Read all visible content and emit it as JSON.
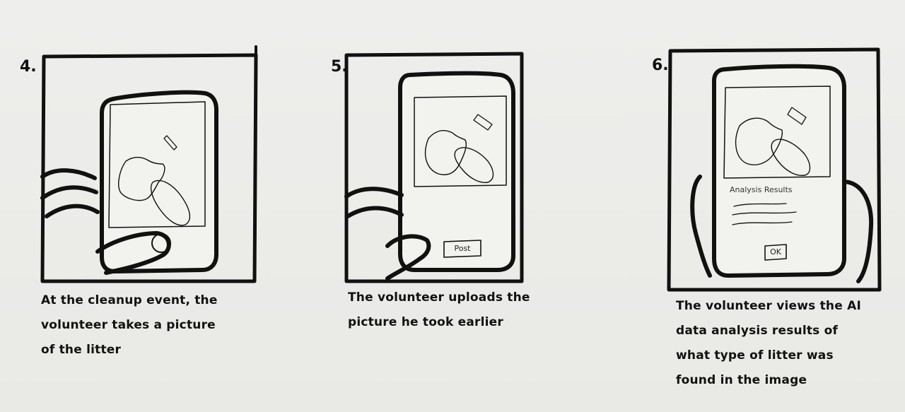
{
  "panels": [
    {
      "number": "4.",
      "caption": "At the cleanup event, the\nvolunteer takes a picture\nof the litter"
    },
    {
      "number": "5.",
      "caption": "The volunteer uploads the\npicture he took earlier",
      "button_label": "Post"
    },
    {
      "number": "6.",
      "caption": "The volunteer views the AI\ndata analysis results of\nwhat type of litter was\nfound in the image",
      "screen_title": "Analysis Results",
      "button_label": "OK"
    }
  ]
}
